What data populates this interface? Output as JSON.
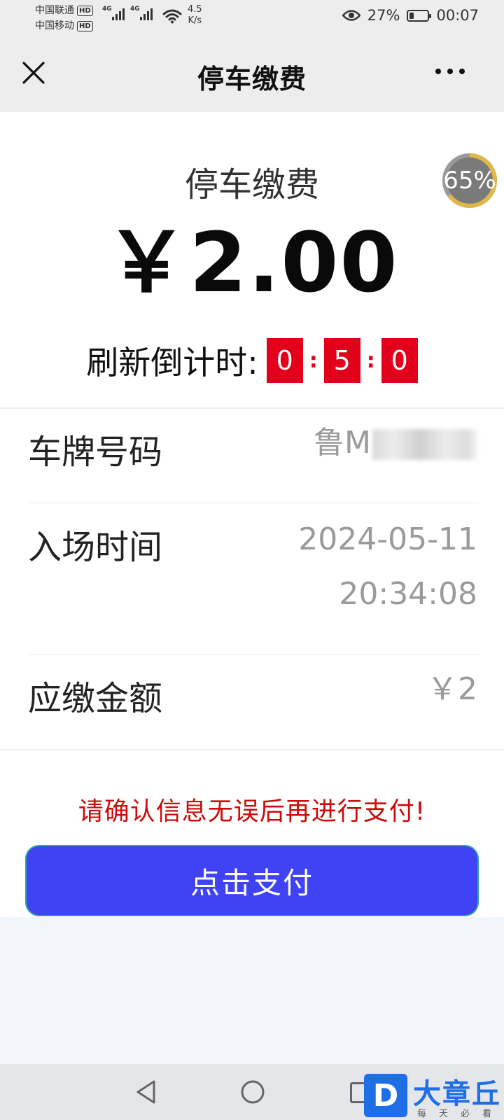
{
  "status_bar": {
    "carrier1": "中国联通",
    "carrier2": "中国移动",
    "hd_badge": "HD",
    "network": "4G",
    "speed_value": "4.5",
    "speed_unit": "K/s",
    "battery_percent": "27%",
    "battery_level": 0.27,
    "time": "00:07"
  },
  "nav": {
    "title": "停车缴费"
  },
  "payment": {
    "title": "停车缴费",
    "amount": "￥2.00",
    "countdown_label": "刷新倒计时:",
    "countdown_digits": [
      "0",
      "5",
      "0"
    ],
    "countdown_separator": ":"
  },
  "progress_badge": {
    "text": "65%",
    "value": 0.65,
    "ring_color": "#e0b84a"
  },
  "details": {
    "plate_label": "车牌号码",
    "plate_value": "鲁M",
    "entry_label": "入场时间",
    "entry_date": "2024-05-11",
    "entry_time": "20:34:08",
    "due_label": "应缴金额",
    "due_value": "￥2"
  },
  "warning": "请确认信息无误后再进行支付!",
  "pay_button": "点击支付",
  "watermark": {
    "logo_letter": "D",
    "name": "大章丘",
    "slogan": "每天必看"
  },
  "colors": {
    "countdown_box": "#e3001b",
    "button": "#3f43f5",
    "warning": "#cc0a0a",
    "brand": "#1e6fe6"
  }
}
